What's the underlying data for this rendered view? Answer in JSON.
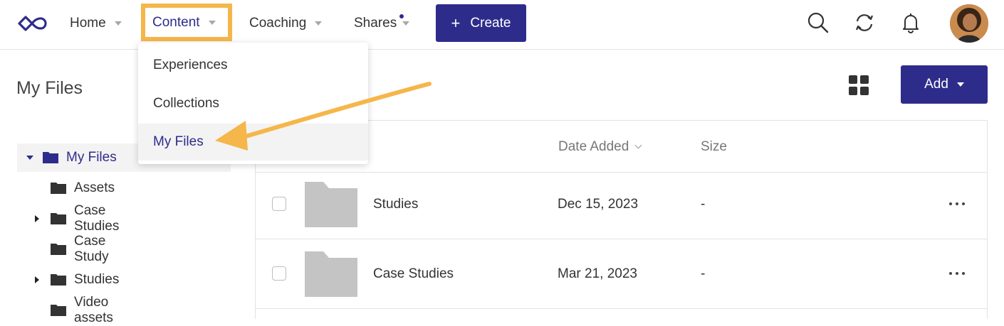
{
  "nav": {
    "home": "Home",
    "content": "Content",
    "coaching": "Coaching",
    "shares": "Shares",
    "create": "Create",
    "icons": [
      "logo-icon",
      "search-icon",
      "sync-icon",
      "bell-icon",
      "avatar"
    ]
  },
  "dropdown": {
    "items": [
      {
        "label": "Experiences"
      },
      {
        "label": "Collections"
      },
      {
        "label": "My Files",
        "active": true
      }
    ]
  },
  "sidebar": {
    "title": "My Files",
    "tree": [
      {
        "label": "My Files",
        "active": true,
        "expanded": true
      },
      {
        "label": "Assets"
      },
      {
        "label": "Case Studies",
        "expandable": true
      },
      {
        "label": "Case Study"
      },
      {
        "label": "Studies",
        "expandable": true
      },
      {
        "label": "Video assets"
      }
    ]
  },
  "toolbar": {
    "add_label": "Add"
  },
  "table": {
    "columns": {
      "date_added": "Date Added",
      "size": "Size"
    },
    "rows": [
      {
        "name": "Studies",
        "date": "Dec 15, 2023",
        "size": "-"
      },
      {
        "name": "Case Studies",
        "date": "Mar 21, 2023",
        "size": "-"
      }
    ]
  },
  "colors": {
    "brand": "#2e2c8b",
    "highlight": "#f5b64a",
    "folder": "#c4c4c4"
  }
}
